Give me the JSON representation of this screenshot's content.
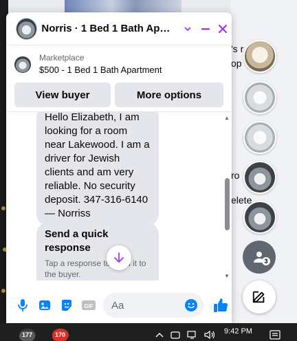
{
  "chat": {
    "title": "Norris · 1 Bed 1 Bath Apart...",
    "marketplace_label": "Marketplace",
    "listing_title": "$500 - 1 Bed 1 Bath Apartment",
    "view_buyer": "View buyer",
    "more_options": "More options",
    "message_text": "Hello Elizabeth, I am looking for a room near Lakewood. I am a driver for Jewish clients and am very reliable. No security deposit. 347-316-6140 — Norriss",
    "quick_title": "Send a quick response",
    "quick_desc": "Tap a response to send it to the buyer.",
    "input_placeholder": "Aa",
    "accent_color": "#a033ff",
    "composer_color": "#0084ff"
  },
  "background": {
    "frag1": "'s r",
    "frag2": "op",
    "frag3": "ro",
    "frag4": "elete",
    "people_badge": "3"
  },
  "taskbar": {
    "time": "9:42 PM",
    "badge1": "177",
    "badge2": "170"
  }
}
